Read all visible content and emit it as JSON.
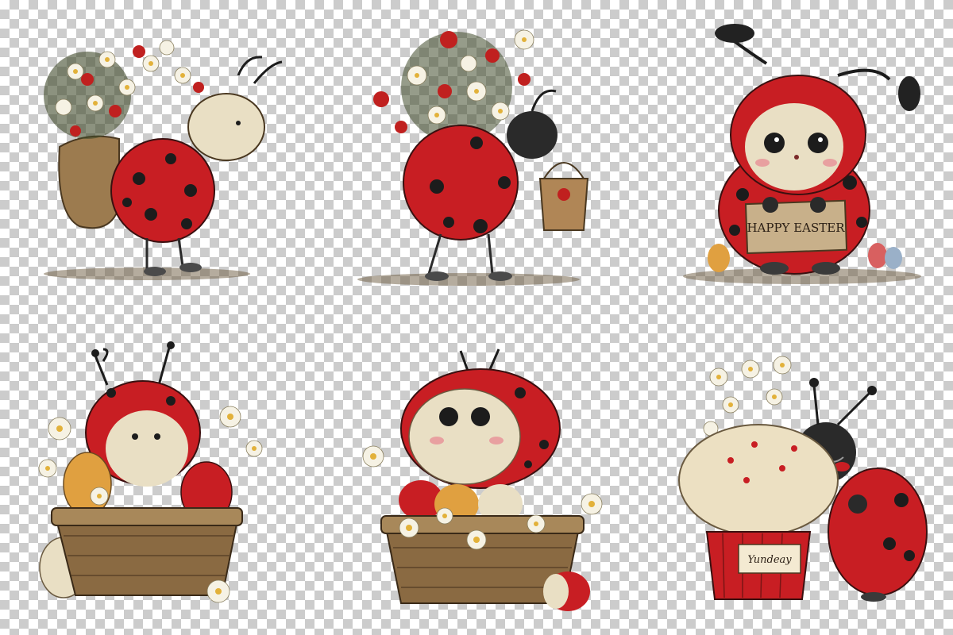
{
  "illustrations": [
    {
      "id": "ladybug-flower-backpack"
    },
    {
      "id": "ladybug-flower-bouquet-basket"
    },
    {
      "id": "ladybug-happy-easter-sign",
      "sign_text": "HAPPY EASTER"
    },
    {
      "id": "ladybug-in-egg-basket"
    },
    {
      "id": "ladybug-dome-in-egg-basket"
    },
    {
      "id": "ladybug-hugging-cupcake",
      "tag_text": "Yundeay"
    }
  ],
  "colors": {
    "ladybug_red": "#c81e23",
    "spot_black": "#1c1c1c",
    "face_cream": "#e9dfc4",
    "basket_brown": "#8a6a42",
    "daisy_white": "#f6f2e4",
    "daisy_center": "#e2b13a",
    "checker_light": "#ffffff",
    "checker_dark": "#cccccc"
  }
}
